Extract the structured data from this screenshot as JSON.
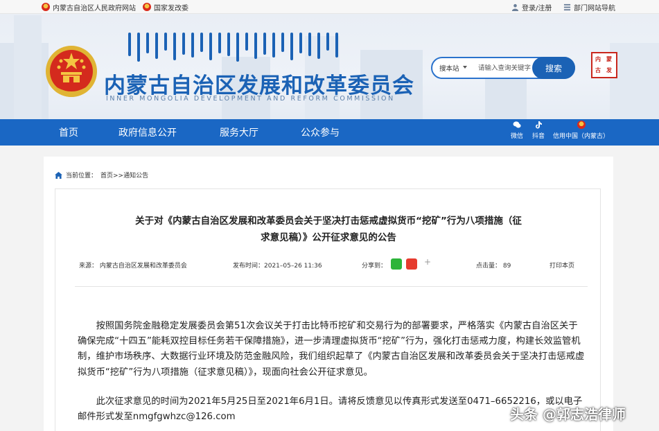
{
  "topbar": {
    "gov_link": "内蒙古自治区人民政府网站",
    "ndrc_link": "国家发改委",
    "login": "登录/注册",
    "dept_nav": "部门网站导航"
  },
  "header": {
    "title_cn": "内蒙古自治区发展和改革委员会",
    "title_en": "INNER MONGOLIA DEVELOPMENT AND REFORM COMMISSION",
    "search": {
      "scope": "搜本站",
      "placeholder": "请输入查询关键字",
      "button": "搜索"
    },
    "seal_chars": [
      "内",
      "蒙",
      "古",
      "发"
    ]
  },
  "nav": {
    "items": [
      "首页",
      "政府信息公开",
      "服务大厅",
      "公众参与"
    ],
    "social": [
      {
        "label": "微信",
        "icon": "wechat-icon"
      },
      {
        "label": "抖音",
        "icon": "douyin-icon"
      },
      {
        "label": "信用中国（内蒙古）",
        "icon": "emblem-icon"
      }
    ]
  },
  "breadcrumb": {
    "label": "当前位置：",
    "path": "首页>>通知公告"
  },
  "article": {
    "title_line1": "关于对《内蒙古自治区发展和改革委员会关于坚决打击惩戒虚拟货币“挖矿”行为八项措施（征",
    "title_line2": "求意见稿）》公开征求意见的公告",
    "source": "来源：  内蒙古自治区发展和改革委员会",
    "publish_time": "发布时间：2021–05–26 11:36",
    "share_label": "分享到：",
    "share_more": "+",
    "clicks": "点击量：  89",
    "print": "打印本页",
    "paragraphs": [
      "按照国务院金融稳定发展委员会第51次会议关于打击比特币挖矿和交易行为的部署要求，严格落实《内蒙古自治区关于确保完成“十四五”能耗双控目标任务若干保障措施》，进一步清理虚拟货币“挖矿”行为，强化打击惩戒力度，构建长效监管机制，维护市场秩序、大数据行业环境及防范金融风险，我们组织起草了《内蒙古自治区发展和改革委员会关于坚决打击惩戒虚拟货币“挖矿”行为八项措施（征求意见稿）》，现面向社会公开征求意见。",
      "此次征求意见的时间为2021年5月25日至2021年6月1日。请将反馈意见以传真形式发送至0471–6652216，或以电子邮件形式发至nmgfgwhzc@126.com"
    ]
  },
  "watermark": "头条 @郭志浩律师",
  "colors": {
    "brand_blue": "#1b62b5",
    "nav_blue": "#1a67c4",
    "seal_red": "#c9261c"
  }
}
